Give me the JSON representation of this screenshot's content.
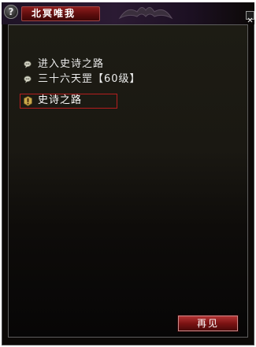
{
  "window": {
    "title": "北冥唯我",
    "help_glyph": "?"
  },
  "dialog": {
    "options": [
      {
        "label": "进入史诗之路",
        "icon": "chat-bubble-icon"
      },
      {
        "label": "三十六天罡【60级】",
        "icon": "chat-bubble-icon"
      }
    ],
    "quest": {
      "label": "史诗之路",
      "icon": "quest-exclamation-icon"
    }
  },
  "footer": {
    "goodbye_label": "再见"
  },
  "colors": {
    "title_plate": "#8e1c1c",
    "quest_border": "#b51e1e",
    "panel_bg": "#0c0907"
  }
}
